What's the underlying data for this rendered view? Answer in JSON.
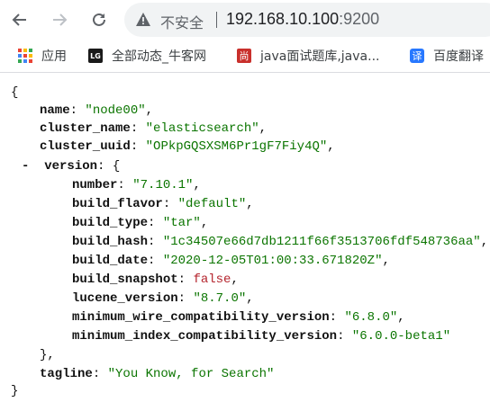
{
  "browser": {
    "nav": {
      "back_icon": "arrow-left-icon",
      "forward_icon": "arrow-right-icon",
      "reload_icon": "reload-icon"
    },
    "omnibox": {
      "security_icon": "warning-triangle-icon",
      "security_label": "不安全",
      "url_host": "192.168.10.100",
      "url_port": ":9200"
    },
    "bookmarks": [
      {
        "label": "应用",
        "icon": "apps-grid-icon"
      },
      {
        "label": "全部动态_牛客网",
        "icon": "nowcoder-icon",
        "icon_text": "LG"
      },
      {
        "label": "java面试题库,java...",
        "icon": "shang-icon",
        "icon_text": "尚"
      },
      {
        "label": "百度翻译",
        "icon": "baidu-translate-icon",
        "icon_text": "译"
      }
    ]
  },
  "json": {
    "open_brace": "{",
    "close_brace": "}",
    "toggle": "-",
    "fields": {
      "name": {
        "key": "name",
        "value": "\"node00\""
      },
      "cluster_name": {
        "key": "cluster_name",
        "value": "\"elasticsearch\""
      },
      "cluster_uuid": {
        "key": "cluster_uuid",
        "value": "\"OPkpGQSXSM6Pr1gF7Fiy4Q\""
      },
      "version": {
        "key": "version",
        "open": "{",
        "close": "},"
      },
      "number": {
        "key": "number",
        "value": "\"7.10.1\""
      },
      "build_flavor": {
        "key": "build_flavor",
        "value": "\"default\""
      },
      "build_type": {
        "key": "build_type",
        "value": "\"tar\""
      },
      "build_hash": {
        "key": "build_hash",
        "value": "\"1c34507e66d7db1211f66f3513706fdf548736aa\""
      },
      "build_date": {
        "key": "build_date",
        "value": "\"2020-12-05T01:00:33.671820Z\""
      },
      "build_snapshot": {
        "key": "build_snapshot",
        "value": "false"
      },
      "lucene_version": {
        "key": "lucene_version",
        "value": "\"8.7.0\""
      },
      "minimum_wire_compatibility_version": {
        "key": "minimum_wire_compatibility_version",
        "value": "\"6.8.0\""
      },
      "minimum_index_compatibility_version": {
        "key": "minimum_index_compatibility_version",
        "value": "\"6.0.0-beta1\""
      },
      "tagline": {
        "key": "tagline",
        "value": "\"You Know, for Search\""
      }
    }
  },
  "colors": {
    "string": "#0b7500",
    "boolean": "#b4232c",
    "omnibox_bg": "#f1f3f4"
  }
}
